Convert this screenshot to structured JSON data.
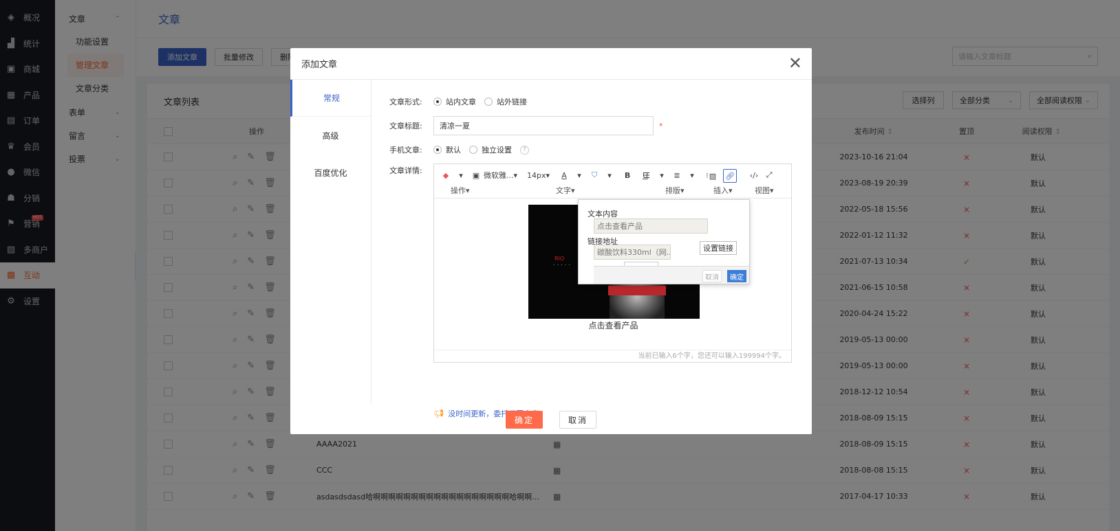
{
  "sidebar": {
    "items": [
      {
        "label": "概况",
        "icon": "layers-icon"
      },
      {
        "label": "统计",
        "icon": "chart-icon"
      },
      {
        "label": "商城",
        "icon": "mall-icon"
      },
      {
        "label": "产品",
        "icon": "grid-icon"
      },
      {
        "label": "订单",
        "icon": "order-icon"
      },
      {
        "label": "会员",
        "icon": "crown-icon"
      },
      {
        "label": "微信",
        "icon": "wechat-icon"
      },
      {
        "label": "分销",
        "icon": "people-icon"
      },
      {
        "label": "营销",
        "icon": "flag-icon",
        "badge": "HOT"
      },
      {
        "label": "多商户",
        "icon": "store-icon"
      },
      {
        "label": "互动",
        "icon": "interact-icon",
        "active": true
      },
      {
        "label": "设置",
        "icon": "gear-icon"
      }
    ]
  },
  "subnav": {
    "group_article": "文章",
    "items": [
      "功能设置",
      "管理文章",
      "文章分类"
    ],
    "groups": [
      "表单",
      "留言",
      "投票"
    ]
  },
  "page": {
    "title": "文章",
    "toolbar": {
      "add": "添加文章",
      "batch": "批量修改",
      "delete": "删除选"
    },
    "search_placeholder": "请输入文章标题",
    "list_title": "文章列表",
    "select_col": "选择列",
    "all_category": "全部分类",
    "all_permission": "全部阅读权限",
    "columns": {
      "op": "操作",
      "date": "发布时间",
      "top": "置顶",
      "perm": "阅读权限"
    }
  },
  "rows": [
    {
      "title": "",
      "date": "2023-10-16 21:04",
      "top": "×",
      "perm": "默认"
    },
    {
      "title": "",
      "date": "2023-08-19 20:39",
      "top": "×",
      "perm": "默认"
    },
    {
      "title": "",
      "date": "2022-05-18 15:56",
      "top": "×",
      "perm": "默认"
    },
    {
      "title": "",
      "date": "2022-01-12 11:32",
      "top": "×",
      "perm": "默认"
    },
    {
      "title": "",
      "date": "2021-07-13 10:34",
      "top": "✓",
      "perm": "默认"
    },
    {
      "title": "",
      "date": "2021-06-15 10:58",
      "top": "×",
      "perm": "默认"
    },
    {
      "title": "",
      "date": "2020-04-24 15:22",
      "top": "×",
      "perm": "默认"
    },
    {
      "title": "",
      "date": "2019-05-13 00:00",
      "top": "×",
      "perm": "默认"
    },
    {
      "title": "",
      "date": "2019-05-13 00:00",
      "top": "×",
      "perm": "默认"
    },
    {
      "title": "",
      "date": "2018-12-12 10:54",
      "top": "×",
      "perm": "默认"
    },
    {
      "title": "",
      "date": "2018-08-09 15:15",
      "top": "×",
      "perm": "默认"
    },
    {
      "title": "AAAA2021",
      "date": "2018-08-09 15:15",
      "top": "×",
      "perm": "默认"
    },
    {
      "title": "CCC",
      "date": "2018-08-08 15:15",
      "top": "×",
      "perm": "默认"
    },
    {
      "title": "asdasdsdasd哈啊啊啊啊啊啊啊啊啊啊啊啊啊啊啊啊啊啊哈啊啊...",
      "date": "2017-04-17 10:33",
      "top": "×",
      "perm": "默认"
    }
  ],
  "modal": {
    "title": "添加文章",
    "close": "✕",
    "tabs": [
      "常规",
      "高级",
      "百度优化"
    ],
    "form": {
      "type_label": "文章形式:",
      "type_options": [
        "站内文章",
        "站外链接"
      ],
      "title_label": "文章标题:",
      "title_value": "清凉一夏",
      "mobile_label": "手机文章:",
      "mobile_options": [
        "默认",
        "独立设置"
      ],
      "detail_label": "文章详情:"
    },
    "editor": {
      "groups": {
        "op": "操作",
        "text": "文字",
        "layout": "排版",
        "insert": "插入",
        "view": "视图"
      },
      "font": "微软雅...",
      "size": "14px",
      "bold": "B",
      "underline": "U",
      "caption": "点击查看产品",
      "status": "当前已输入6个字，您还可以输入199994个字。",
      "image_brand": "RIO",
      "popup": {
        "text_label": "文本内容",
        "text_value": "点击查看产品",
        "url_label": "链接地址",
        "url_value": "碳酸饮料330ml（网...",
        "set_link": "设置链接",
        "cancel": "取消",
        "ok": "确定"
      }
    },
    "tip": "没时间更新，委托代写文章",
    "ok": "确定",
    "cancel": "取消"
  },
  "colors": {
    "accent": "#3b63c9",
    "orange": "#ff6b4a",
    "sidebar": "#191a23"
  }
}
